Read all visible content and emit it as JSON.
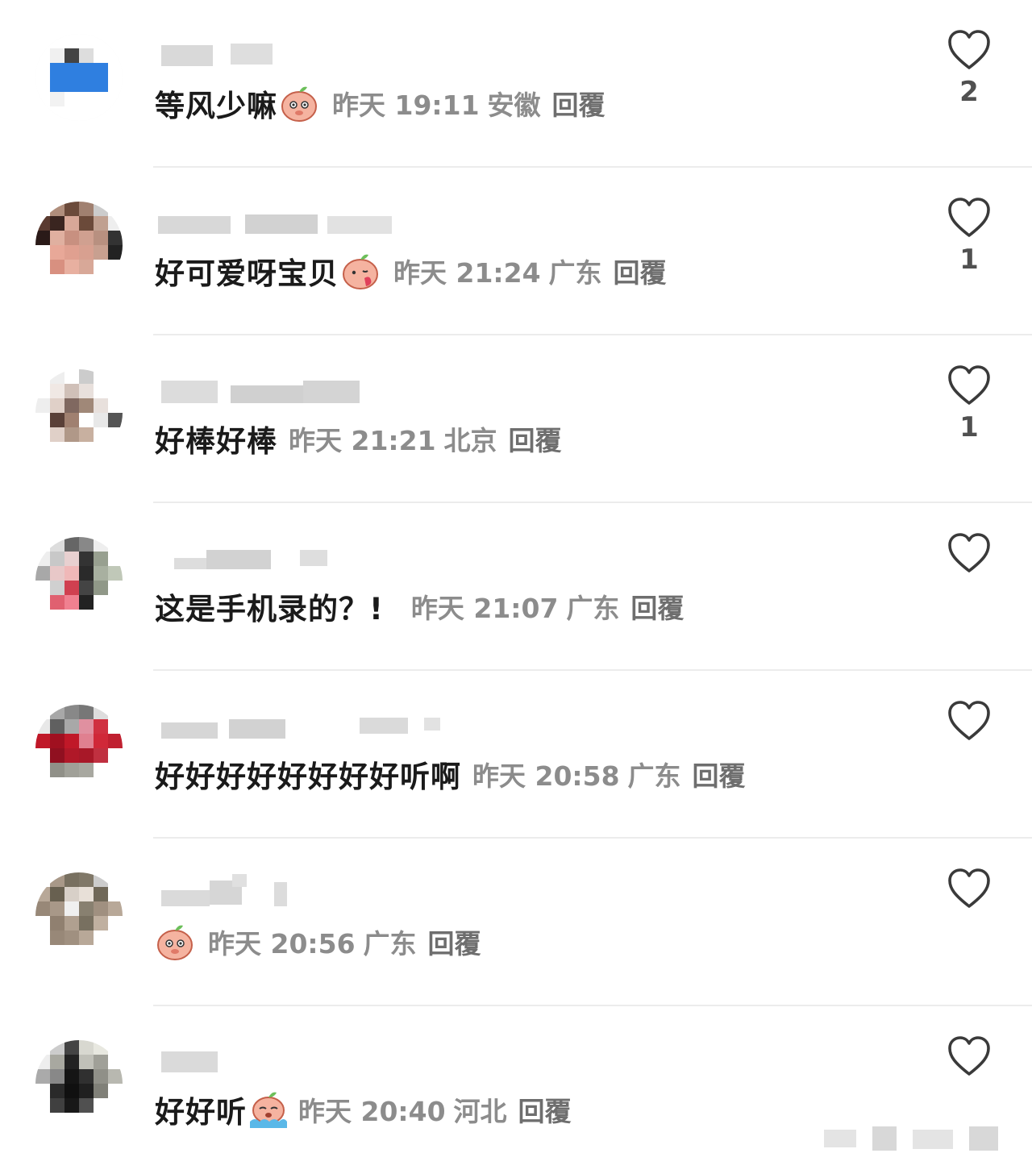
{
  "colors": {
    "text": "#1a1a1a",
    "meta": "#8c8c8c",
    "divider": "#ececec",
    "heart_outline": "#3a3a3a"
  },
  "comments": [
    {
      "text": "等风少嘛",
      "emoji": "peach-shy-emoji",
      "time": "昨天 19:11",
      "location": "安徽",
      "reply_label": "回覆",
      "likes": "2"
    },
    {
      "text": "好可爱呀宝贝",
      "emoji": "peach-kiss-emoji",
      "time": "昨天 21:24",
      "location": "广东",
      "reply_label": "回覆",
      "likes": "1"
    },
    {
      "text": "好棒好棒",
      "emoji": "",
      "time": "昨天 21:21",
      "location": "北京",
      "reply_label": "回覆",
      "likes": "1"
    },
    {
      "text": "这是手机录的？!",
      "emoji": "",
      "time": "昨天 21:07",
      "location": "广东",
      "reply_label": "回覆",
      "likes": ""
    },
    {
      "text": "好好好好好好好好听啊",
      "emoji": "",
      "time": "昨天 20:58",
      "location": "广东",
      "reply_label": "回覆",
      "likes": ""
    },
    {
      "text": "",
      "emoji": "peach-shy-emoji",
      "time": "昨天 20:56",
      "location": "广东",
      "reply_label": "回覆",
      "likes": ""
    },
    {
      "text": "好好听",
      "emoji": "peach-crying-emoji",
      "time": "昨天 20:40",
      "location": "河北",
      "reply_label": "回覆",
      "likes": ""
    }
  ]
}
